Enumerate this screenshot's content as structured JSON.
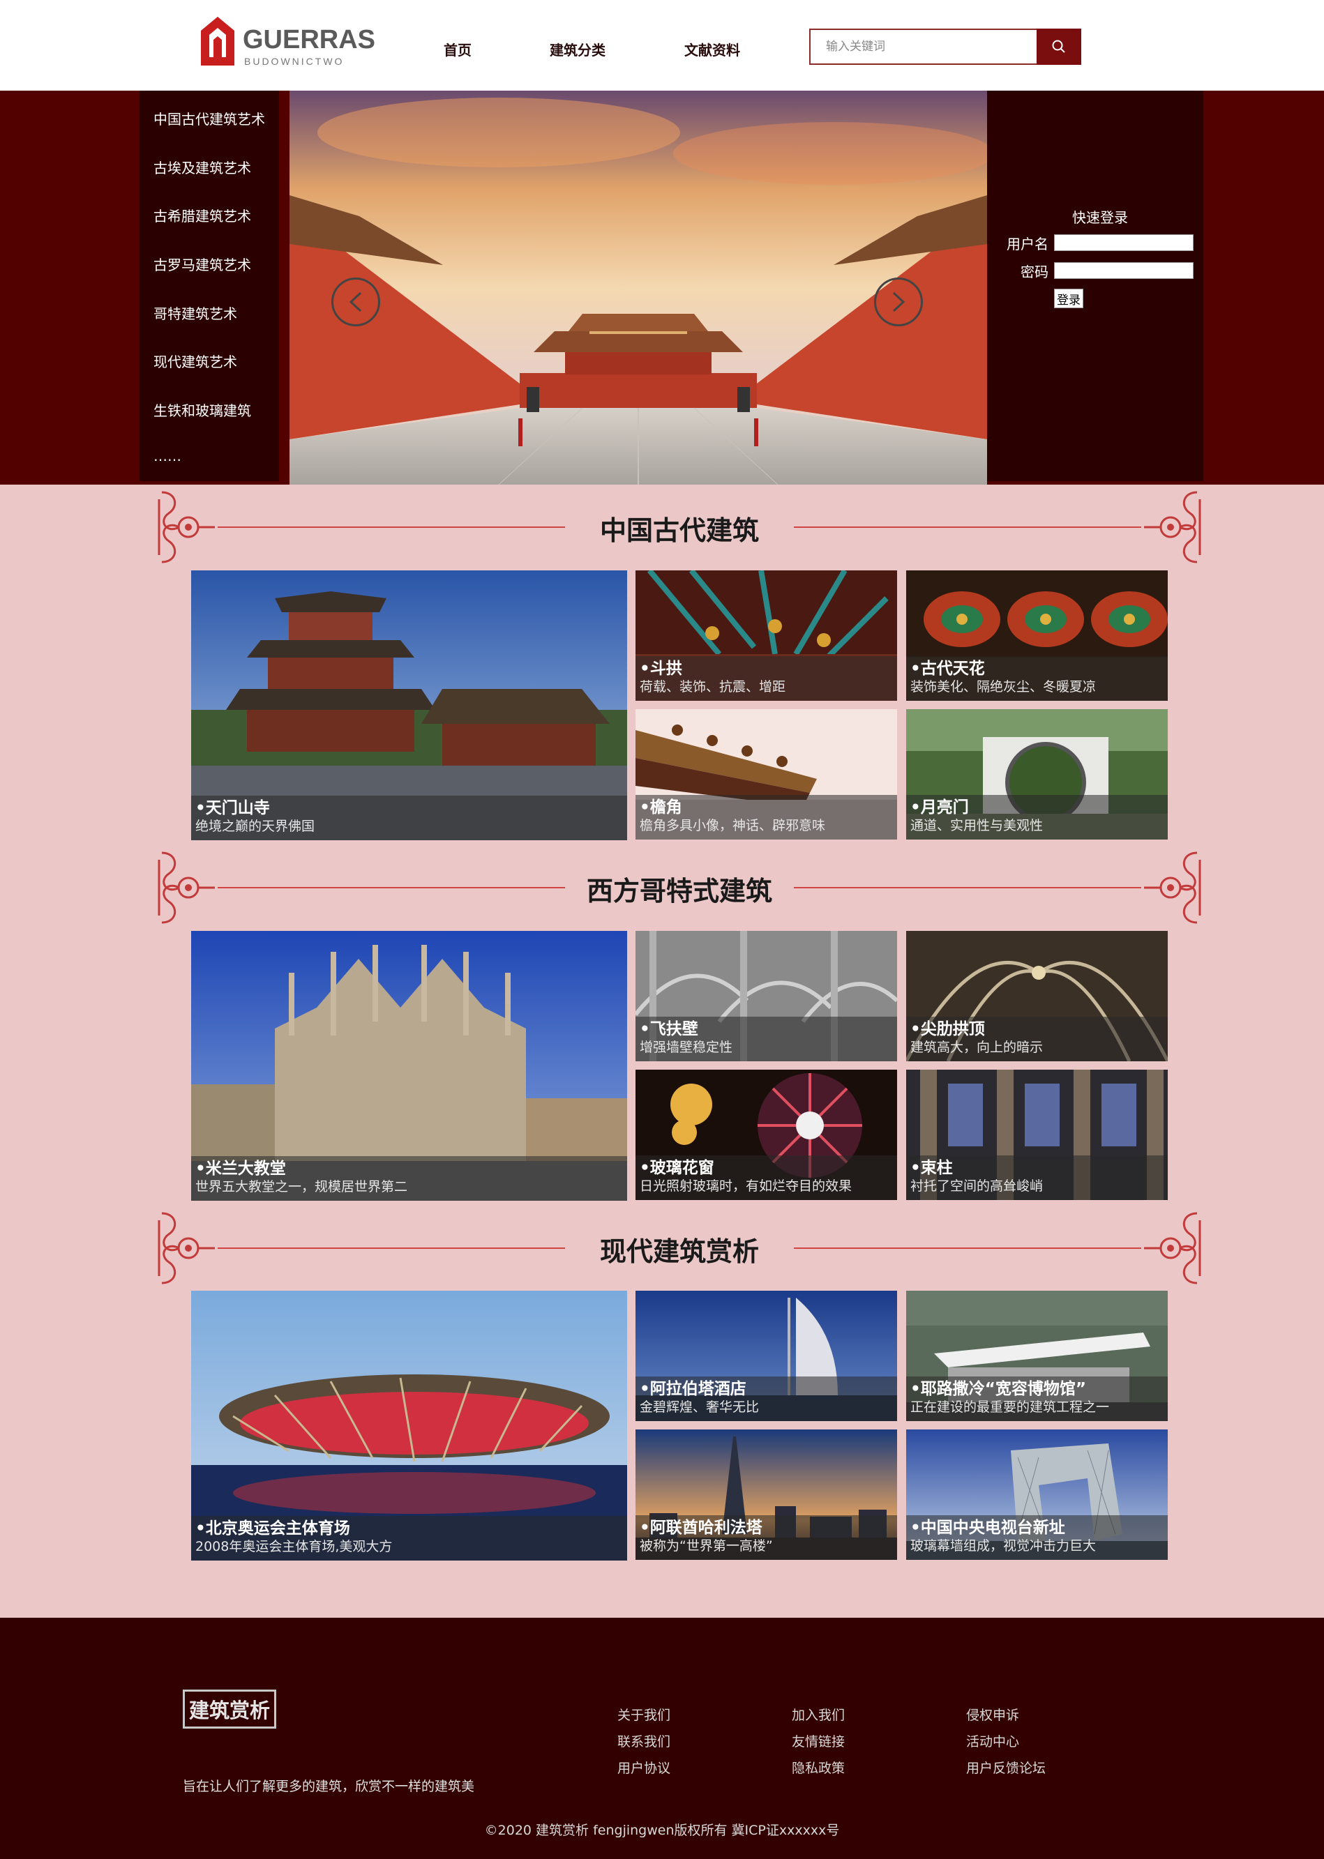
{
  "header": {
    "logo_name": "GUERRAS",
    "logo_sub": "BUDOWNICTWO",
    "nav": [
      "首页",
      "建筑分类",
      "文献资料"
    ],
    "search_placeholder": "输入关键词",
    "search_icon": "search-icon"
  },
  "side_menu": [
    "中国古代建筑艺术",
    "古埃及建筑艺术",
    "古希腊建筑艺术",
    "古罗马建筑艺术",
    "哥特建筑艺术",
    "现代建筑艺术",
    "生铁和玻璃建筑",
    "……"
  ],
  "login": {
    "title": "快速登录",
    "username_label": "用户名",
    "password_label": "密码",
    "button": "登录"
  },
  "sections": [
    {
      "title": "中国古代建筑",
      "tiles": [
        {
          "title": "•天门山寺",
          "desc": "绝境之巅的天界佛国"
        },
        {
          "title": "•斗拱",
          "desc": "荷载、装饰、抗震、增距"
        },
        {
          "title": "•古代天花",
          "desc": "装饰美化、隔绝灰尘、冬暖夏凉"
        },
        {
          "title": "•檐角",
          "desc": "檐角多具小像，神话、辟邪意味"
        },
        {
          "title": "•月亮门",
          "desc": "通道、实用性与美观性"
        }
      ]
    },
    {
      "title": "西方哥特式建筑",
      "tiles": [
        {
          "title": "•米兰大教堂",
          "desc": "世界五大教堂之一，规模居世界第二"
        },
        {
          "title": "•飞扶壁",
          "desc": "增强墙壁稳定性"
        },
        {
          "title": "•尖肋拱顶",
          "desc": "建筑高大，向上的暗示"
        },
        {
          "title": "•玻璃花窗",
          "desc": "日光照射玻璃时，有如烂夺目的效果"
        },
        {
          "title": "•束柱",
          "desc": "衬托了空间的高耸峻峭"
        }
      ]
    },
    {
      "title": "现代建筑赏析",
      "tiles": [
        {
          "title": "•北京奥运会主体育场",
          "desc": "2008年奥运会主体育场,美观大方"
        },
        {
          "title": "•阿拉伯塔酒店",
          "desc": "金碧辉煌、奢华无比"
        },
        {
          "title": "•耶路撒冷“宽容博物馆”",
          "desc": "正在建设的最重要的建筑工程之一"
        },
        {
          "title": "•阿联酋哈利法塔",
          "desc": "被称为“世界第一高楼”"
        },
        {
          "title": "•中国中央电视台新址",
          "desc": "玻璃幕墙组成，视觉冲击力巨大"
        }
      ]
    }
  ],
  "footer": {
    "logo": "建筑赏析",
    "tagline": "旨在让人们了解更多的建筑，欣赏不一样的建筑美",
    "links": [
      [
        "关于我们",
        "联系我们",
        "用户协议"
      ],
      [
        "加入我们",
        "友情链接",
        "隐私政策"
      ],
      [
        "侵权申诉",
        "活动中心",
        "用户反馈论坛"
      ]
    ],
    "copyright": "©2020 建筑赏析 fengjingwen版权所有 冀ICP证xxxxxx号"
  },
  "colors": {
    "brand_dark": "#530000",
    "panel": "#2b0000",
    "footer": "#330000",
    "page_bg": "#ebc7c7",
    "accent_line": "#d14545",
    "search_button": "#7a0d0d"
  }
}
